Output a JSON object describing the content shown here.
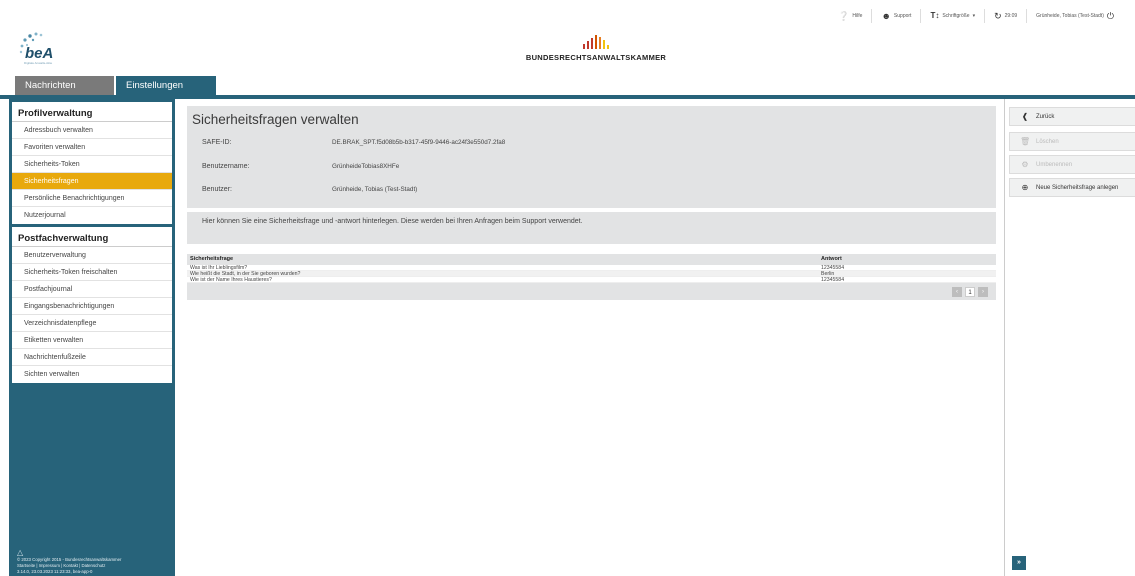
{
  "topbar": {
    "help": {
      "icon": "question-circle-icon",
      "label": "Hilfe"
    },
    "support": {
      "icon": "user-icon",
      "label": "Support"
    },
    "fontsize": {
      "icon": "text-size-icon",
      "label": "Schriftgröße",
      "caret": "▾"
    },
    "session": {
      "icon": "refresh-icon",
      "label": "29:09"
    },
    "user": {
      "label": "Grünheide, Tobias (Test-Stadt)",
      "icon": "power-icon"
    }
  },
  "logo": {
    "text": "beA",
    "subtitle": "Digitale Anwalts-Akte"
  },
  "brak": {
    "name": "BUNDESRECHTSANWALTSKAMMER"
  },
  "tabs": [
    {
      "label": "Nachrichten",
      "active": false
    },
    {
      "label": "Einstellungen",
      "active": true
    }
  ],
  "sidebar": {
    "profile": {
      "title": "Profilverwaltung",
      "items": [
        "Adressbuch verwalten",
        "Favoriten verwalten",
        "Sicherheits-Token",
        "Sicherheitsfragen",
        "Persönliche Benachrichtigungen",
        "Nutzerjournal"
      ],
      "selected": "Sicherheitsfragen"
    },
    "postfach": {
      "title": "Postfachverwaltung",
      "items": [
        "Benutzerverwaltung",
        "Sicherheits-Token freischalten",
        "Postfachjournal",
        "Eingangsbenachrichtigungen",
        "Verzeichnisdatenpflege",
        "Etiketten verwalten",
        "Nachrichtenfußzeile",
        "Sichten verwalten"
      ]
    },
    "footer": {
      "line1": "© 2023 Copyright 2015 - Bundesrechtsanwaltskammer",
      "line2": "Startseite | Impressum | Kontakt | Datenschutz",
      "line3": "3.14.0, 23.03.2023 11:23:33, bea-app-0"
    }
  },
  "main": {
    "title": "Sicherheitsfragen verwalten",
    "fields": [
      {
        "label": "SAFE-ID:",
        "value": "DE.BRAK_SPT.f5d08b5b-b317-45f9-9446-ac24f3e550d7.2fa8"
      },
      {
        "label": "Benutzername:",
        "value": "GrünheideTobias8XHFe"
      },
      {
        "label": "Benutzer:",
        "value": "Grünheide, Tobias (Test-Stadt)"
      }
    ],
    "info": "Hier können Sie eine Sicherheitsfrage und -antwort hinterlegen. Diese werden bei Ihren Anfragen beim Support verwendet.",
    "table": {
      "headers": [
        "Sicherheitsfrage",
        "Antwort"
      ],
      "rows": [
        [
          "Was ist Ihr Lieblingsfilm?",
          "12345584"
        ],
        [
          "Wie heißt die Stadt, in der Sie geboren wurden?",
          "Berlin"
        ],
        [
          "Wie ist der Name Ihres Haustieres?",
          "12345584"
        ]
      ]
    },
    "pager": {
      "prev": "‹",
      "page": "1",
      "next": "›"
    }
  },
  "actions": [
    {
      "label": "Zurück",
      "icon": "back-arrow-icon",
      "enabled": true
    },
    {
      "label": "Löschen",
      "icon": "trash-icon",
      "enabled": false
    },
    {
      "label": "Umbenennen",
      "icon": "gear-icon",
      "enabled": false
    },
    {
      "label": "Neue Sicherheitsfrage anlegen",
      "icon": "add-circle-icon",
      "enabled": true
    }
  ],
  "expand": {
    "label": "»"
  },
  "colors": {
    "brand": "#27637a",
    "selected": "#e8a90d",
    "panel": "#e2e3e4"
  }
}
